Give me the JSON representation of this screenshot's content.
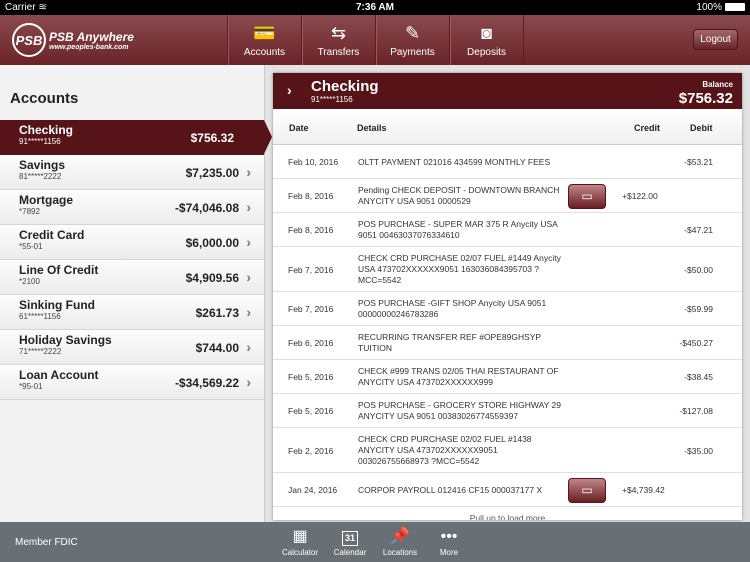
{
  "status": {
    "carrier": "Carrier",
    "time": "7:36 AM",
    "battery": "100%"
  },
  "brand": {
    "logo_mark": "PSB",
    "name": "PSB Anywhere",
    "url": "www.peoples-bank.com"
  },
  "nav": {
    "tabs": [
      {
        "label": "Accounts",
        "icon": "credit-card-icon"
      },
      {
        "label": "Transfers",
        "icon": "transfer-arrows-icon"
      },
      {
        "label": "Payments",
        "icon": "check-pen-icon"
      },
      {
        "label": "Deposits",
        "icon": "camera-icon"
      }
    ],
    "logout": "Logout"
  },
  "sidebar": {
    "title": "Accounts",
    "accounts": [
      {
        "name": "Checking",
        "number": "91*****1156",
        "balance": "$756.32",
        "selected": true
      },
      {
        "name": "Savings",
        "number": "81*****2222",
        "balance": "$7,235.00"
      },
      {
        "name": "Mortgage",
        "number": "*7892",
        "balance": "-$74,046.08"
      },
      {
        "name": "Credit Card",
        "number": "*55-01",
        "balance": "$6,000.00"
      },
      {
        "name": "Line Of Credit",
        "number": "*2100",
        "balance": "$4,909.56"
      },
      {
        "name": "Sinking Fund",
        "number": "61*****1156",
        "balance": "$261.73"
      },
      {
        "name": "Holiday Savings",
        "number": "71*****2222",
        "balance": "$744.00"
      },
      {
        "name": "Loan Account",
        "number": "*95-01",
        "balance": "-$34,569.22"
      }
    ]
  },
  "detail": {
    "title": "Checking",
    "number": "91*****1156",
    "balance_label": "Balance",
    "balance": "$756.32",
    "columns": {
      "date": "Date",
      "details": "Details",
      "credit": "Credit",
      "debit": "Debit"
    },
    "transactions": [
      {
        "date": "Feb 10, 2016",
        "details": "OLTT PAYMENT 021016 434599 MONTHLY FEES",
        "credit": "",
        "debit": "-$53.21"
      },
      {
        "date": "Feb 8, 2016",
        "details": "Pending CHECK DEPOSIT - DOWNTOWN BRANCH ANYCITY USA 9051 0000529",
        "credit": "+$122.00",
        "debit": "",
        "image_button": true
      },
      {
        "date": "Feb 8, 2016",
        "details": "POS PURCHASE -  SUPER MAR 375 R Anycity USA 9051 00463037076334610",
        "credit": "",
        "debit": "-$47.21"
      },
      {
        "date": "Feb 7, 2016",
        "details": "CHECK CRD PURCHASE 02/07  FUEL #1449 Anycity USA 473702XXXXXX9051 163036084395703 ?MCC=5542",
        "credit": "",
        "debit": "-$50.00"
      },
      {
        "date": "Feb 7, 2016",
        "details": "POS PURCHASE -GIFT SHOP Anycity USA 9051 00000000246783286",
        "credit": "",
        "debit": "-$59.99"
      },
      {
        "date": "Feb 6, 2016",
        "details": "RECURRING TRANSFER REF #OPE89GHSYP TUITION",
        "credit": "",
        "debit": "-$450.27"
      },
      {
        "date": "Feb 5, 2016",
        "details": "CHECK #999 TRANS 02/05 THAI RESTAURANT OF ANYCITY USA 473702XXXXXX999",
        "credit": "",
        "debit": "-$38.45"
      },
      {
        "date": "Feb 5, 2016",
        "details": "POS PURCHASE - GROCERY STORE HIGHWAY 29 ANYCITY USA 9051 00383026774559397",
        "credit": "",
        "debit": "-$127.08"
      },
      {
        "date": "Feb 2, 2016",
        "details": "CHECK CRD PURCHASE 02/02 FUEL #1438 ANYCITY USA 473702XXXXXX9051 003026755668973 ?MCC=5542",
        "credit": "",
        "debit": "-$35.00"
      },
      {
        "date": "Jan 24, 2016",
        "details": "CORPOR PAYROLL 012416 CF15 000037177 X",
        "credit": "+$4,739.42",
        "debit": "",
        "image_button": true
      }
    ],
    "pull_more": "Pull up to load more"
  },
  "footer": {
    "fdic": "Member FDIC",
    "items": [
      {
        "label": "Calculator"
      },
      {
        "label": "Calendar",
        "day": "31"
      },
      {
        "label": "Locations"
      },
      {
        "label": "More"
      }
    ]
  }
}
